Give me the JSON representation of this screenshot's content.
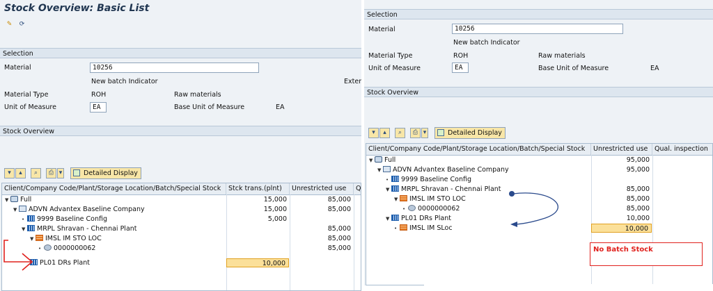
{
  "left": {
    "title": "Stock Overview: Basic List",
    "selection_header": "Selection",
    "material_label": "Material",
    "material_value": "10256",
    "batch_indicator": "New batch Indicator",
    "extern_text": "Exter",
    "material_type_label": "Material Type",
    "material_type_value": "ROH",
    "raw_materials": "Raw materials",
    "uom_label": "Unit of Measure",
    "uom_value": "EA",
    "base_uom_label": "Base Unit of Measure",
    "base_uom_value": "EA",
    "stock_overview_header": "Stock Overview",
    "detailed_display": "Detailed Display",
    "columns": [
      "Client/Company Code/Plant/Storage Location/Batch/Special Stock",
      "Stck trans.(plnt)",
      "Unrestricted use",
      "Qu"
    ],
    "rows": [
      {
        "label": "Full",
        "c1": "15,000",
        "c2": "85,000"
      },
      {
        "label": "ADVN Advantex Baseline Company",
        "c1": "15,000",
        "c2": "85,000"
      },
      {
        "label": "9999 Baseline Config",
        "c1": "5,000",
        "c2": ""
      },
      {
        "label": "MRPL Shravan - Chennai Plant",
        "c1": "",
        "c2": "85,000"
      },
      {
        "label": "IMSL IM STO LOC",
        "c1": "",
        "c2": "85,000"
      },
      {
        "label": "0000000062",
        "c1": "",
        "c2": "85,000"
      },
      {
        "label": "PL01 DRs Plant",
        "c1": "10,000",
        "c2": ""
      }
    ]
  },
  "right": {
    "selection_header": "Selection",
    "material_label": "Material",
    "material_value": "10256",
    "batch_indicator": "New batch Indicator",
    "material_type_label": "Material Type",
    "material_type_value": "ROH",
    "raw_materials": "Raw materials",
    "uom_label": "Unit of Measure",
    "uom_value": "EA",
    "base_uom_label": "Base Unit of Measure",
    "base_uom_value": "EA",
    "stock_overview_header": "Stock Overview",
    "detailed_display": "Detailed Display",
    "columns": [
      "Client/Company Code/Plant/Storage Location/Batch/Special Stock",
      "Unrestricted use",
      "Qual. inspection"
    ],
    "rows": [
      {
        "label": "Full",
        "c1": "95,000"
      },
      {
        "label": "ADVN Advantex Baseline Company",
        "c1": "95,000"
      },
      {
        "label": "9999 Baseline Config",
        "c1": ""
      },
      {
        "label": "MRPL Shravan - Chennai Plant",
        "c1": "85,000"
      },
      {
        "label": "IMSL IM STO LOC",
        "c1": "85,000"
      },
      {
        "label": "0000000062",
        "c1": "85,000"
      },
      {
        "label": "PL01 DRs Plant",
        "c1": "10,000"
      },
      {
        "label": "IMSL IM SLoc",
        "c1": "10,000"
      }
    ],
    "callout": "No Batch Stock"
  },
  "colors": {
    "annotation_red": "#e0201c",
    "highlight": "#fbe09a",
    "arrow": "#2a4a8c"
  }
}
